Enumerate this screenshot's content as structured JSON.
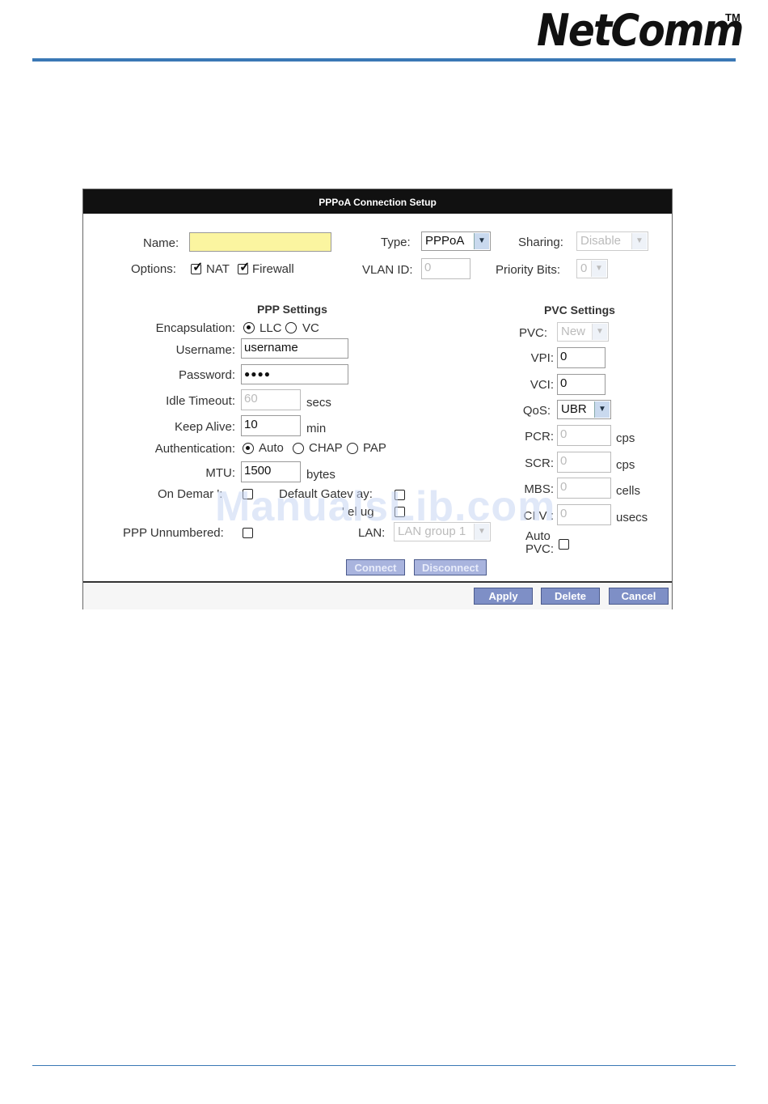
{
  "brand": {
    "logo": "NetComm",
    "trademark": "TM",
    "accent": "#3a78b5"
  },
  "dialog": {
    "title": "PPPoA Connection Setup",
    "name": {
      "label": "Name:",
      "value": ""
    },
    "type": {
      "label": "Type:",
      "value": "PPPoA"
    },
    "sharing": {
      "label": "Sharing:",
      "value": "Disable"
    },
    "options": {
      "label": "Options:",
      "nat": "NAT",
      "firewall": "Firewall"
    },
    "vlan": {
      "label": "VLAN ID:",
      "value": "0"
    },
    "priority": {
      "label": "Priority Bits:",
      "value": "0"
    }
  },
  "ppp": {
    "heading": "PPP Settings",
    "encapsulation": {
      "label": "Encapsulation:",
      "llc": "LLC",
      "vc": "VC"
    },
    "username": {
      "label": "Username:",
      "value": "username"
    },
    "password": {
      "label": "Password:",
      "value": "●●●●"
    },
    "idle_timeout": {
      "label": "Idle Timeout:",
      "value": "60",
      "unit": "secs"
    },
    "keep_alive": {
      "label": "Keep Alive:",
      "value": "10",
      "unit": "min"
    },
    "authentication": {
      "label": "Authentication:",
      "auto": "Auto",
      "chap": "CHAP",
      "pap": "PAP"
    },
    "mtu": {
      "label": "MTU:",
      "value": "1500",
      "unit": "bytes"
    },
    "on_demand": {
      "label": "On Demar ':"
    },
    "default_gateway": {
      "label": "Default Gatev ay:"
    },
    "debug": {
      "label": "' el ug"
    },
    "unnumbered": {
      "label": "PPP Unnumbered:"
    },
    "lan": {
      "label": "LAN:",
      "value": "LAN group 1"
    }
  },
  "pvc": {
    "heading": "PVC Settings",
    "pvc": {
      "label": "PVC:",
      "value": "New"
    },
    "vpi": {
      "label": "VPI:",
      "value": "0"
    },
    "vci": {
      "label": "VCI:",
      "value": "0"
    },
    "qos": {
      "label": "QoS:",
      "value": "UBR"
    },
    "pcr": {
      "label": "PCR:",
      "value": "0",
      "unit": "cps"
    },
    "scr": {
      "label": "SCR:",
      "value": "0",
      "unit": "cps"
    },
    "mbs": {
      "label": "MBS:",
      "value": "0",
      "unit": "cells"
    },
    "cdvt": {
      "label": "CI V :",
      "value": "0",
      "unit": "usecs"
    },
    "auto_pvc": {
      "label_line1": "Auto",
      "label_line2": "PVC:"
    }
  },
  "buttons": {
    "connect": "Connect",
    "disconnect": "Disconnect",
    "apply": "Apply",
    "delete": "Delete",
    "cancel": "Cancel"
  },
  "watermark": "ManualsLib.com"
}
